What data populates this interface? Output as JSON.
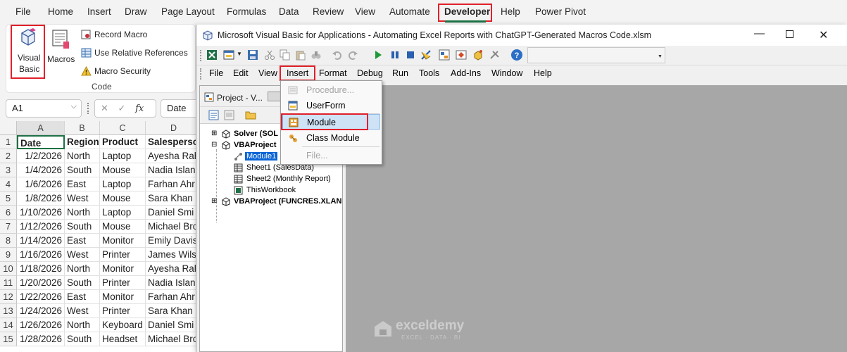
{
  "excel": {
    "menu_tabs": [
      "File",
      "Home",
      "Insert",
      "Draw",
      "Page Layout",
      "Formulas",
      "Data",
      "Review",
      "View",
      "Automate",
      "Developer",
      "Help",
      "Power Pivot"
    ],
    "ribbon": {
      "visual_basic_line1": "Visual",
      "visual_basic_line2": "Basic",
      "macros": "Macros",
      "record_macro": "Record Macro",
      "relative_refs": "Use Relative References",
      "macro_security": "Macro Security",
      "group_label": "Code"
    },
    "formula_bar": {
      "name_box": "A1",
      "fx": "fx",
      "value": "Date"
    },
    "columns": [
      "A",
      "B",
      "C",
      "D"
    ],
    "rows": [
      [
        "Date",
        "Region",
        "Product",
        "Salesperson"
      ],
      [
        "1/2/2026",
        "North",
        "Laptop",
        "Ayesha Rah"
      ],
      [
        "1/4/2026",
        "South",
        "Mouse",
        "Nadia Islan"
      ],
      [
        "1/6/2026",
        "East",
        "Laptop",
        "Farhan Ahr"
      ],
      [
        "1/8/2026",
        "West",
        "Mouse",
        "Sara Khan"
      ],
      [
        "1/10/2026",
        "North",
        "Laptop",
        "Daniel Smi"
      ],
      [
        "1/12/2026",
        "South",
        "Mouse",
        "Michael Bro"
      ],
      [
        "1/14/2026",
        "East",
        "Monitor",
        "Emily Davis"
      ],
      [
        "1/16/2026",
        "West",
        "Printer",
        "James Wils"
      ],
      [
        "1/18/2026",
        "North",
        "Monitor",
        "Ayesha Rah"
      ],
      [
        "1/20/2026",
        "South",
        "Printer",
        "Nadia Islan"
      ],
      [
        "1/22/2026",
        "East",
        "Monitor",
        "Farhan Ahr"
      ],
      [
        "1/24/2026",
        "West",
        "Printer",
        "Sara Khan"
      ],
      [
        "1/26/2026",
        "North",
        "Keyboard",
        "Daniel Smi"
      ],
      [
        "1/28/2026",
        "South",
        "Headset",
        "Michael Bro"
      ]
    ]
  },
  "vba": {
    "title": "Microsoft Visual Basic for Applications - Automating Excel Reports with ChatGPT-Generated Macros Code.xlsm",
    "menu": [
      "File",
      "Edit",
      "View",
      "Insert",
      "Format",
      "Debug",
      "Run",
      "Tools",
      "Add-Ins",
      "Window",
      "Help"
    ],
    "project_title": "Project - V...",
    "tree": {
      "solver": "Solver (SOL",
      "vbaproject": "VBAProject",
      "module1": "Module1",
      "sheet1": "Sheet1 (SalesData)",
      "sheet2": "Sheet2 (Monthly Report)",
      "thisworkbook": "ThisWorkbook",
      "funcres": "VBAProject (FUNCRES.XLAN"
    },
    "insert_menu": [
      "Procedure...",
      "UserForm",
      "Module",
      "Class Module",
      "File..."
    ]
  },
  "watermark": {
    "name": "exceldemy",
    "tagline": "EXCEL · DATA · BI"
  },
  "colors": {
    "highlight_red": "#e0202a",
    "selection_blue": "#0a64d6",
    "code_area": "#a7a7a7",
    "excel_green": "#1e7145"
  }
}
